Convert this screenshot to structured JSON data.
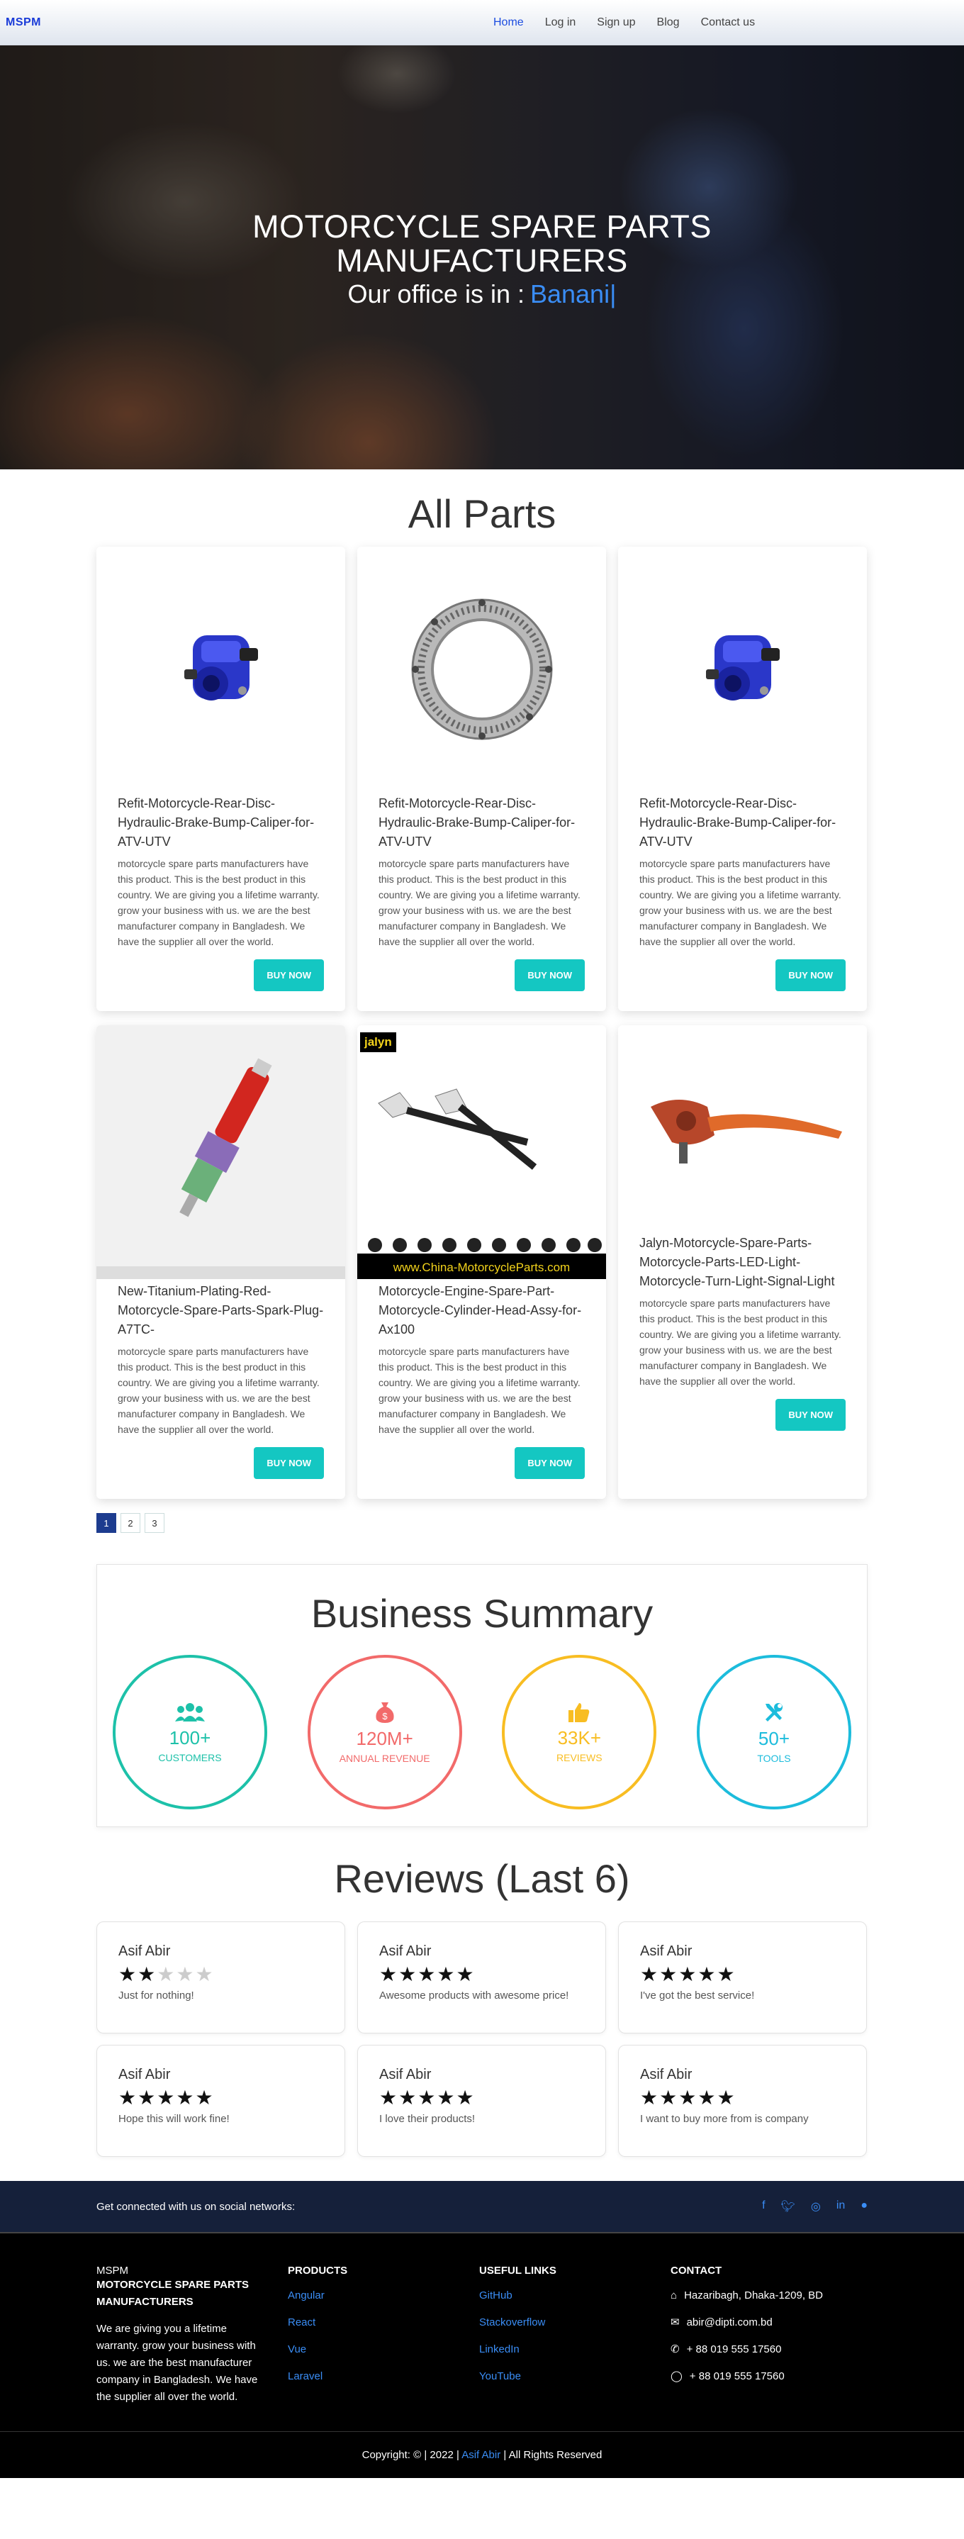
{
  "nav": {
    "brand": "MSPM",
    "links": [
      "Home",
      "Log in",
      "Sign up",
      "Blog",
      "Contact us"
    ]
  },
  "hero": {
    "title_line1": "MOTORCYCLE SPARE PARTS",
    "title_line2": "MANUFACTURERS",
    "office_prefix": "Our office is in :",
    "office_city": "Banani|"
  },
  "parts": {
    "title": "All Parts",
    "items": [
      {
        "title": "Refit-Motorcycle-Rear-Disc-Hydraulic-Brake-Bump-Caliper-for-ATV-UTV",
        "desc": "motorcycle spare parts manufacturers have this product. This is the best product in this country. We are giving you a lifetime warranty. grow your business with us. we are the best manufacturer company in Bangladesh. We have the supplier all over the world.",
        "button": "BUY NOW",
        "image": "brake-caliper"
      },
      {
        "title": "Refit-Motorcycle-Rear-Disc-Hydraulic-Brake-Bump-Caliper-for-ATV-UTV",
        "desc": "motorcycle spare parts manufacturers have this product. This is the best product in this country. We are giving you a lifetime warranty. grow your business with us. we are the best manufacturer company in Bangladesh. We have the supplier all over the world.",
        "button": "BUY NOW",
        "image": "brake-disc"
      },
      {
        "title": "Refit-Motorcycle-Rear-Disc-Hydraulic-Brake-Bump-Caliper-for-ATV-UTV",
        "desc": "motorcycle spare parts manufacturers have this product. This is the best product in this country. We are giving you a lifetime warranty. grow your business with us. we are the best manufacturer company in Bangladesh. We have the supplier all over the world.",
        "button": "BUY NOW",
        "image": "brake-caliper"
      },
      {
        "title": "New-Titanium-Plating-Red-Motorcycle-Spare-Parts-Spark-Plug-A7TC-",
        "desc": "motorcycle spare parts manufacturers have this product. This is the best product in this country. We are giving you a lifetime warranty. grow your business with us. we are the best manufacturer company in Bangladesh. We have the supplier all over the world.",
        "button": "BUY NOW",
        "image": "spark-plug"
      },
      {
        "title": "Motorcycle-Engine-Spare-Part-Motorcycle-Cylinder-Head-Assy-for-Ax100",
        "desc": "motorcycle spare parts manufacturers have this product. This is the best product in this country. We are giving you a lifetime warranty. grow your business with us. we are the best manufacturer company in Bangladesh. We have the supplier all over the world.",
        "button": "BUY NOW",
        "image": "turn-signals",
        "image_logo": "jalyn",
        "image_url_text": "www.China-MotorcycleParts.com"
      },
      {
        "title": "Jalyn-Motorcycle-Spare-Parts-Motorcycle-Parts-LED-Light-Motorcycle-Turn-Light-Signal-Light",
        "desc": "motorcycle spare parts manufacturers have this product. This is the best product in this country. We are giving you a lifetime warranty. grow your business with us. we are the best manufacturer company in Bangladesh. We have the supplier all over the world.",
        "button": "BUY NOW",
        "image": "clutch-lever"
      }
    ],
    "pages": [
      "1",
      "2",
      "3"
    ],
    "current_page": "1"
  },
  "summary": {
    "title": "Business Summary",
    "stats": [
      {
        "value": "100+",
        "label": "CUSTOMERS",
        "color": "#1dc1a9",
        "icon": "users-icon"
      },
      {
        "value": "120M+",
        "label": "ANNUAL REVENUE",
        "color": "#f26a6a",
        "icon": "money-bag-icon"
      },
      {
        "value": "33K+",
        "label": "REVIEWS",
        "color": "#f8bd22",
        "icon": "thumbs-up-icon"
      },
      {
        "value": "50+",
        "label": "TOOLS",
        "color": "#1cbcdc",
        "icon": "tools-icon"
      }
    ]
  },
  "reviews": {
    "title": "Reviews (Last 6)",
    "items": [
      {
        "name": "Asif Abir",
        "rating": 2,
        "text": "Just for nothing!"
      },
      {
        "name": "Asif Abir",
        "rating": 5,
        "text": "Awesome products with awesome price!"
      },
      {
        "name": "Asif Abir",
        "rating": 5,
        "text": "I've got the best service!"
      },
      {
        "name": "Asif Abir",
        "rating": 5,
        "text": "Hope this will work fine!"
      },
      {
        "name": "Asif Abir",
        "rating": 5,
        "text": "I love their products!"
      },
      {
        "name": "Asif Abir",
        "rating": 5,
        "text": "I want to buy more from is company"
      }
    ]
  },
  "social": {
    "text": "Get connected with us on social networks:",
    "icons": [
      "facebook-icon",
      "twitter-icon",
      "instagram-icon",
      "linkedin-icon",
      "github-icon"
    ]
  },
  "footer": {
    "brand": "MSPM",
    "brand_full": "MOTORCYCLE SPARE PARTS MANUFACTURERS",
    "about": "We are giving you a lifetime warranty. grow your business with us. we are the best manufacturer company in Bangladesh. We have the supplier all over the world.",
    "products_title": "PRODUCTS",
    "products": [
      "Angular",
      "React",
      "Vue",
      "Laravel"
    ],
    "links_title": "USEFUL LINKS",
    "links": [
      "GitHub",
      "Stackoverflow",
      "LinkedIn",
      "YouTube"
    ],
    "contact_title": "CONTACT",
    "address": "Hazaribagh, Dhaka-1209, BD",
    "email": "abir@dipti.com.bd",
    "phone": "+ 88 019 555 17560",
    "whatsapp": "+ 88 019 555 17560",
    "copyright_prefix": "Copyright: © | 2022 |",
    "copyright_author": "Asif Abir",
    "copyright_suffix": "| All Rights Reserved"
  }
}
